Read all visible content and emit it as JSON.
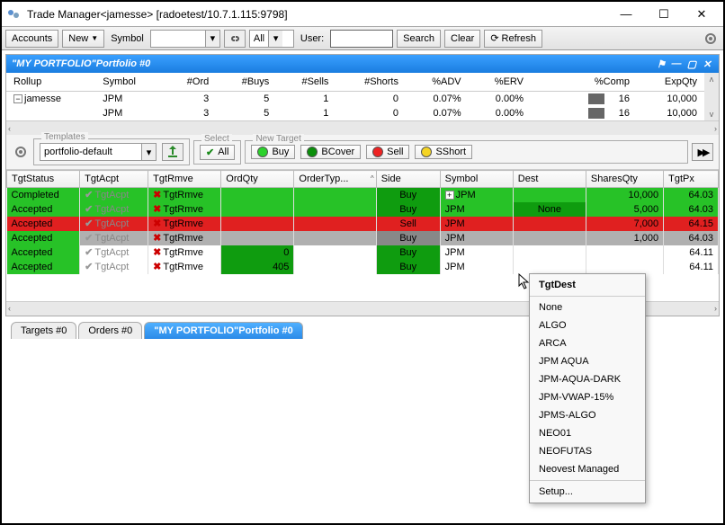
{
  "window": {
    "title": "Trade Manager<jamesse> [radoetest/10.7.1.115:9798]"
  },
  "toolbar": {
    "accounts": "Accounts",
    "new": "New",
    "symbol": "Symbol",
    "all": "All",
    "user": "User:",
    "search": "Search",
    "clear": "Clear",
    "refresh": "Refresh"
  },
  "panel": {
    "title": "\"MY PORTFOLIO\"Portfolio #0"
  },
  "summary": {
    "cols": [
      "Rollup",
      "Symbol",
      "#Ord",
      "#Buys",
      "#Sells",
      "#Shorts",
      "%ADV",
      "%ERV",
      "%Comp",
      "ExpQty"
    ],
    "r1": {
      "rollup": "jamesse",
      "symbol": "JPM",
      "ord": "3",
      "buys": "5",
      "sells": "1",
      "shorts": "0",
      "adv": "0.07%",
      "erv": "0.00%",
      "comp": "16",
      "exp": "10,000"
    },
    "r2": {
      "rollup": "",
      "symbol": "JPM",
      "ord": "3",
      "buys": "5",
      "sells": "1",
      "shorts": "0",
      "adv": "0.07%",
      "erv": "0.00%",
      "comp": "16",
      "exp": "10,000"
    }
  },
  "mid": {
    "templates_legend": "Templates",
    "select_legend": "Select",
    "newtarget_legend": "New Target",
    "template_value": "portfolio-default",
    "all": "All",
    "buy": "Buy",
    "bcover": "BCover",
    "sell": "Sell",
    "sshort": "SShort"
  },
  "detail": {
    "cols": {
      "tgtstatus": "TgtStatus",
      "tgtacpt": "TgtAcpt",
      "tgtrmve": "TgtRmve",
      "ordqty": "OrdQty",
      "ordertype": "OrderTyp...",
      "side": "Side",
      "symbol": "Symbol",
      "dest": "Dest",
      "sharesqty": "SharesQty",
      "tgtpx": "TgtPx"
    },
    "rows": [
      {
        "status": "Completed",
        "acpt": "TgtAcpt",
        "rmve": "TgtRmve",
        "ordqty": "",
        "side": "Buy",
        "symbol": "JPM",
        "dest": "",
        "shares": "10,000",
        "tgtpx": "64.03",
        "rowClass": "row-green",
        "sideClass": "cell-dgreen",
        "hasExpand": true
      },
      {
        "status": "Accepted",
        "acpt": "TgtAcpt",
        "rmve": "TgtRmve",
        "ordqty": "",
        "side": "Buy",
        "symbol": "JPM",
        "dest": "None",
        "shares": "5,000",
        "tgtpx": "64.03",
        "rowClass": "row-green",
        "sideClass": "cell-dgreen",
        "destClass": "cell-dgreen"
      },
      {
        "status": "Accepted",
        "acpt": "TgtAcpt",
        "rmve": "TgtRmve",
        "ordqty": "",
        "side": "Sell",
        "symbol": "JPM",
        "dest": "",
        "shares": "7,000",
        "tgtpx": "64.15",
        "rowClass": "row-red",
        "statusClass": "cell-red",
        "sideClass": "cell-red",
        "ordqtyClass": "cell-red",
        "destClass": "cell-red"
      },
      {
        "status": "Accepted",
        "acpt": "TgtAcpt",
        "rmve": "TgtRmve",
        "ordqty": "",
        "side": "Buy",
        "symbol": "JPM",
        "dest": "",
        "shares": "1,000",
        "tgtpx": "64.03",
        "rowClass": "row-sel",
        "statusClass": "cell-green",
        "sideClass": "cell-gray"
      },
      {
        "status": "Accepted",
        "acpt": "TgtAcpt",
        "rmve": "TgtRmve",
        "ordqty": "0",
        "side": "Buy",
        "symbol": "JPM",
        "dest": "",
        "shares": "",
        "tgtpx": "64.11",
        "rowClass": "",
        "statusClass": "cell-green",
        "sideClass": "cell-dgreen",
        "ordqtyClass": "cell-dgreen"
      },
      {
        "status": "Accepted",
        "acpt": "TgtAcpt",
        "rmve": "TgtRmve",
        "ordqty": "405",
        "side": "Buy",
        "symbol": "JPM",
        "dest": "",
        "shares": "",
        "tgtpx": "64.11",
        "rowClass": "",
        "statusClass": "cell-green",
        "sideClass": "cell-dgreen",
        "ordqtyClass": "cell-dgreen"
      }
    ]
  },
  "tabs": {
    "targets": "Targets #0",
    "orders": "Orders #0",
    "portfolio": "\"MY PORTFOLIO\"Portfolio #0"
  },
  "menu": {
    "title": "TgtDest",
    "items": [
      "None",
      "ALGO",
      "ARCA",
      "JPM AQUA",
      "JPM-AQUA-DARK",
      "JPM-VWAP-15%",
      "JPMS-ALGO",
      "NEO01",
      "NEOFUTAS",
      "Neovest Managed"
    ],
    "setup": "Setup..."
  }
}
